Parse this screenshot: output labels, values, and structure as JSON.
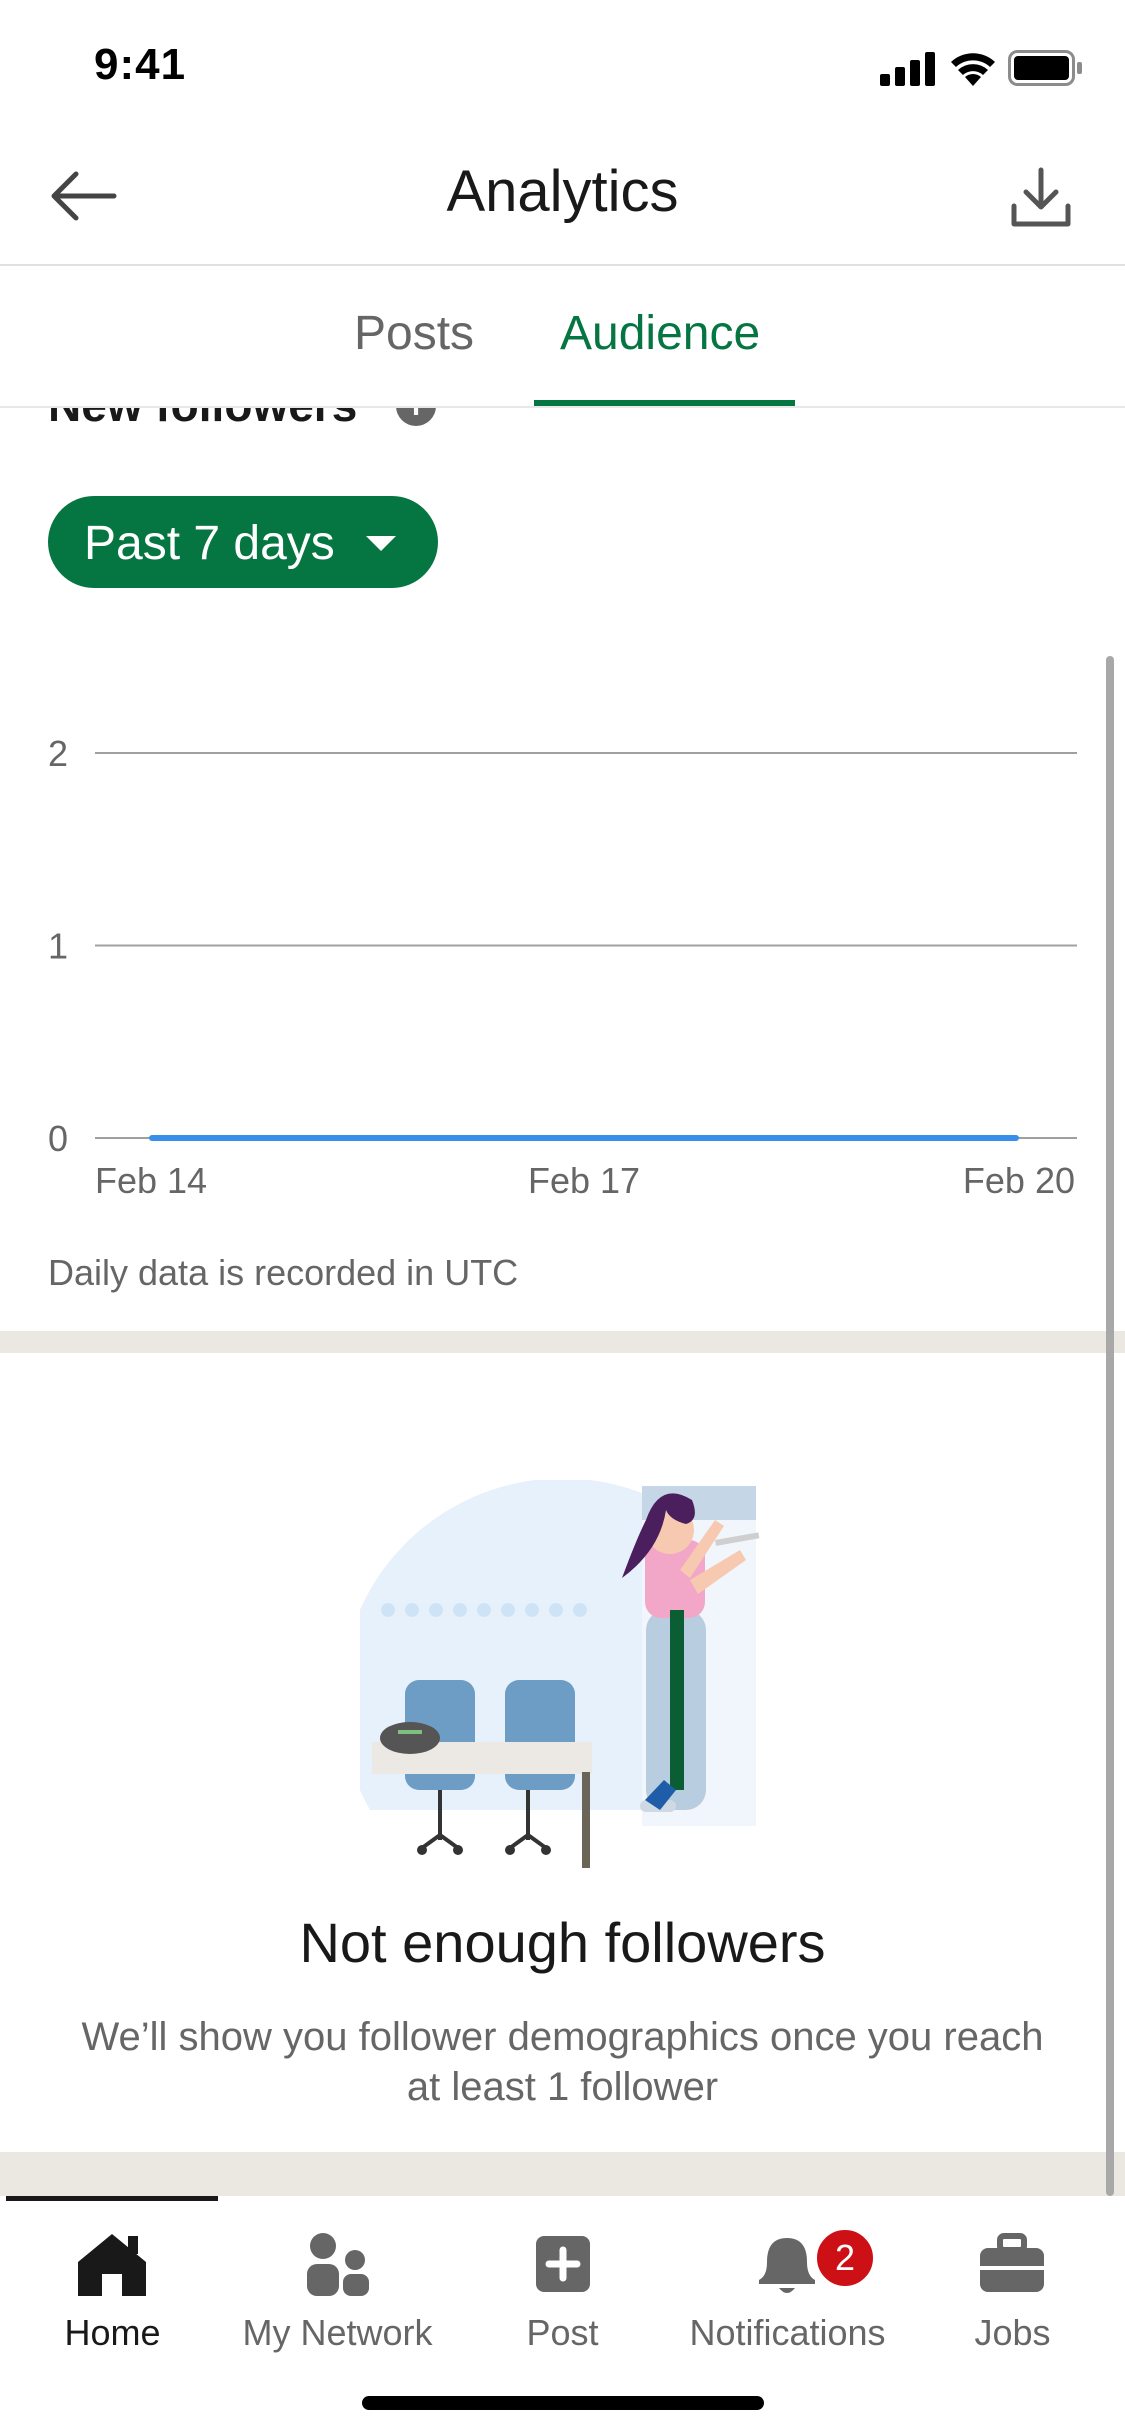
{
  "status_bar": {
    "time": "9:41"
  },
  "header": {
    "title": "Analytics"
  },
  "tabs": [
    {
      "label": "Posts",
      "active": false
    },
    {
      "label": "Audience",
      "active": true
    }
  ],
  "section": {
    "heading": "New followers"
  },
  "filter": {
    "label": "Past 7 days"
  },
  "chart_data": {
    "type": "line",
    "x": [
      "Feb 14",
      "Feb 15",
      "Feb 16",
      "Feb 17",
      "Feb 18",
      "Feb 19",
      "Feb 20"
    ],
    "x_tick_labels": [
      "Feb 14",
      "Feb 17",
      "Feb 20"
    ],
    "y_ticks": [
      0,
      1,
      2
    ],
    "ylim": [
      0,
      2
    ],
    "series": [
      {
        "values": [
          0,
          0,
          0,
          0,
          0,
          0,
          0
        ],
        "color": "#378fe9"
      }
    ],
    "grid": true
  },
  "chart_note": "Daily data is recorded in UTC",
  "empty_state": {
    "title": "Not enough followers",
    "description": "We’ll show you follower demographics once you reach at least 1 follower"
  },
  "bottom_nav": [
    {
      "label": "Home",
      "icon": "home-icon",
      "active": true
    },
    {
      "label": "My Network",
      "icon": "people-icon",
      "active": false
    },
    {
      "label": "Post",
      "icon": "plus-square-icon",
      "active": false
    },
    {
      "label": "Notifications",
      "icon": "bell-icon",
      "active": false,
      "badge": "2"
    },
    {
      "label": "Jobs",
      "icon": "briefcase-icon",
      "active": false
    }
  ],
  "colors": {
    "brand_green": "#057642",
    "series_blue": "#378fe9",
    "badge_red": "#cc1016",
    "section_gap": "#ebe8e2"
  }
}
